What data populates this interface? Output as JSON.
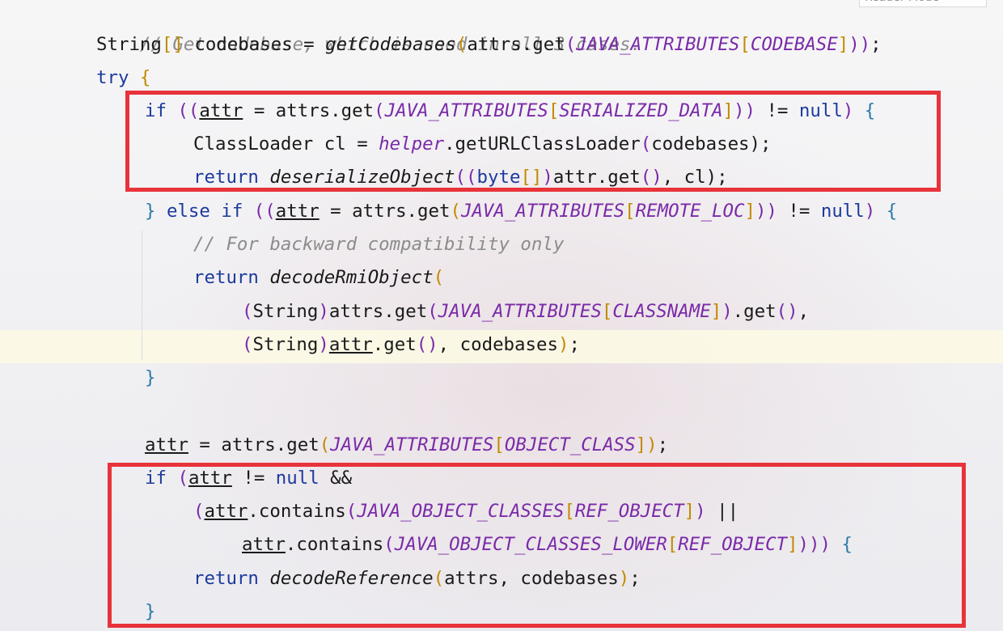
{
  "editor": {
    "reader_mode_label": "Reader Mode",
    "lines": {
      "l1": "// Get codebase, which is used in all 3 cases.",
      "l2a": "String",
      "l2b": "[]",
      "l2c": " codebases = ",
      "l2d": "getCodebases",
      "l2e": "(",
      "l2f": "attrs.get",
      "l2g": "(",
      "l2h": "JAVA_ATTRIBUTES",
      "l2i": "[",
      "l2j": "CODEBASE",
      "l2k": "]",
      "l2l": "))",
      "l2m": ";",
      "l3a": "try",
      "l3b": " {",
      "l4a": "if",
      "l4b": " ((",
      "l4c": "attr",
      "l4d": " = attrs.get",
      "l4e": "(",
      "l4f": "JAVA_ATTRIBUTES",
      "l4g": "[",
      "l4h": "SERIALIZED_DATA",
      "l4i": "]",
      "l4j": "))",
      "l4k": " != ",
      "l4l": "null",
      "l4m": ")",
      "l4n": " {",
      "l5a": "ClassLoader cl = ",
      "l5b": "helper",
      "l5c": ".getURLClassLoader",
      "l5d": "(",
      "l5e": "codebases",
      "l5f": ");",
      "l6a": "return",
      "l6b": " deserializeObject",
      "l6c": "((",
      "l6d": "byte",
      "l6e": "[]",
      "l6f": ")",
      "l6g": "attr.get",
      "l6h": "()",
      "l6i": ", cl);",
      "l7a": "}",
      "l7b": " else if",
      "l7c": " ((",
      "l7d": "attr",
      "l7e": " = attrs.get",
      "l7f": "(",
      "l7g": "JAVA_ATTRIBUTES",
      "l7h": "[",
      "l7i": "REMOTE_LOC",
      "l7j": "]",
      "l7k": "))",
      "l7l": " != ",
      "l7m": "null",
      "l7n": ")",
      "l7o": " {",
      "l8": "// For backward compatibility only",
      "l9a": "return",
      "l9b": " decodeRmiObject",
      "l9c": "(",
      "l10a": "(",
      "l10b": "String",
      "l10c": ")",
      "l10d": "attrs.get",
      "l10e": "(",
      "l10f": "JAVA_ATTRIBUTES",
      "l10g": "[",
      "l10h": "CLASSNAME",
      "l10i": "]",
      "l10j": ")",
      "l10k": ".get",
      "l10l": "()",
      "l10m": ",",
      "l11a": "(",
      "l11b": "String",
      "l11c": ")",
      "l11d": "attr",
      "l11e": ".get",
      "l11f": "()",
      "l11g": ", codebases",
      "l11h": ")",
      "l11i": ";",
      "l12": "}",
      "l13a": "attr",
      "l13b": " = attrs.get",
      "l13c": "(",
      "l13d": "JAVA_ATTRIBUTES",
      "l13e": "[",
      "l13f": "OBJECT_CLASS",
      "l13g": "]",
      "l13h": ")",
      "l13i": ";",
      "l14a": "if",
      "l14b": " (",
      "l14c": "attr",
      "l14d": " != ",
      "l14e": "null",
      "l14f": " &&",
      "l15a": "(",
      "l15b": "attr",
      "l15c": ".contains",
      "l15d": "(",
      "l15e": "JAVA_OBJECT_CLASSES",
      "l15f": "[",
      "l15g": "REF_OBJECT",
      "l15h": "]",
      "l15i": ")",
      "l15j": " ||",
      "l16a": "attr",
      "l16b": ".contains",
      "l16c": "(",
      "l16d": "JAVA_OBJECT_CLASSES_LOWER",
      "l16e": "[",
      "l16f": "REF_OBJECT",
      "l16g": "]",
      "l16h": ")))",
      "l16i": " {",
      "l17a": "return",
      "l17b": " decodeReference",
      "l17c": "(",
      "l17d": "attrs, codebases",
      "l17e": ")",
      "l17f": ";",
      "l18": "}"
    }
  },
  "annotations": {
    "box_color": "#e8333a"
  }
}
